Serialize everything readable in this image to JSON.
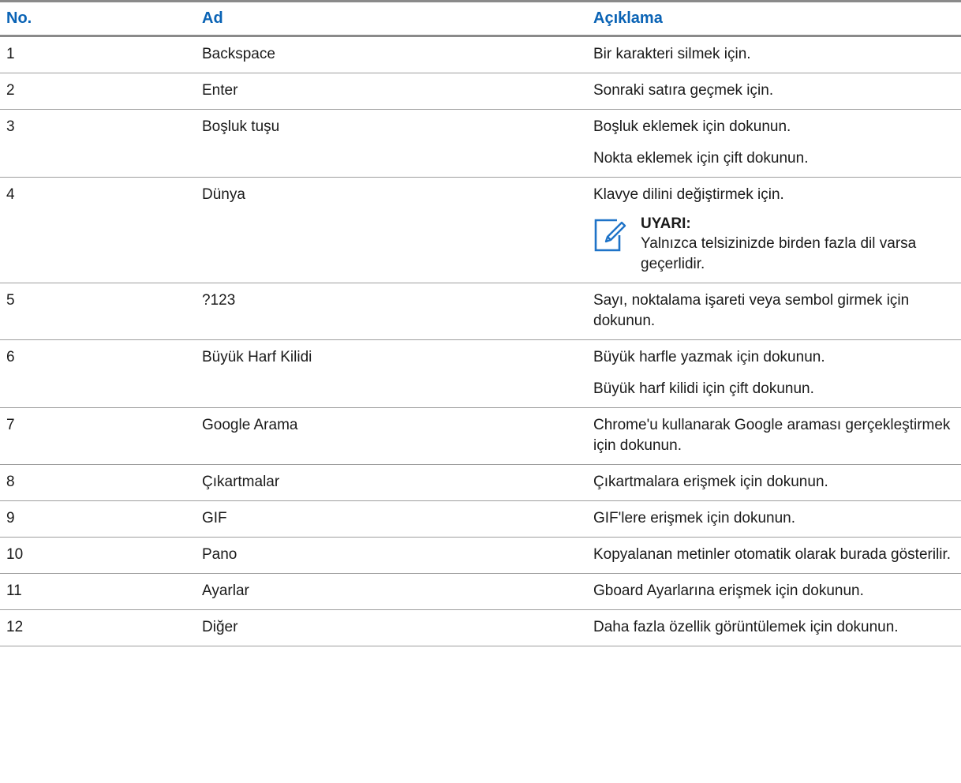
{
  "table": {
    "headers": [
      "No.",
      "Ad",
      "Açıklama"
    ],
    "rows": [
      {
        "no": "1",
        "name": "Backspace",
        "desc": [
          "Bir karakteri silmek için."
        ]
      },
      {
        "no": "2",
        "name": "Enter",
        "desc": [
          "Sonraki satıra geçmek için."
        ]
      },
      {
        "no": "3",
        "name": "Boşluk tuşu",
        "desc": [
          "Boşluk eklemek için dokunun.",
          "Nokta eklemek için çift dokunun."
        ]
      },
      {
        "no": "4",
        "name": "Dünya",
        "desc": [
          "Klavye dilini değiştirmek için."
        ],
        "note": {
          "icon": "note-pencil-icon",
          "title": "UYARI:",
          "text": "Yalnızca telsizinizde birden fazla dil varsa geçerlidir."
        }
      },
      {
        "no": "5",
        "name": "?123",
        "desc": [
          "Sayı, noktalama işareti veya sembol girmek için dokunun."
        ]
      },
      {
        "no": "6",
        "name": "Büyük Harf Kilidi",
        "desc": [
          "Büyük harfle yazmak için dokunun.",
          "Büyük harf kilidi için çift dokunun."
        ]
      },
      {
        "no": "7",
        "name": "Google Arama",
        "desc": [
          "Chrome'u kullanarak Google araması gerçekleştirmek için dokunun."
        ]
      },
      {
        "no": "8",
        "name": "Çıkartmalar",
        "desc": [
          "Çıkartmalara erişmek için dokunun."
        ]
      },
      {
        "no": "9",
        "name": "GIF",
        "desc": [
          "GIF'lere erişmek için dokunun."
        ]
      },
      {
        "no": "10",
        "name": "Pano",
        "desc": [
          "Kopyalanan metinler otomatik olarak burada gösterilir."
        ]
      },
      {
        "no": "11",
        "name": "Ayarlar",
        "desc": [
          "Gboard Ayarlarına erişmek için dokunun."
        ]
      },
      {
        "no": "12",
        "name": "Diğer",
        "desc": [
          "Daha fazla özellik görüntülemek için dokunun."
        ]
      }
    ]
  },
  "colors": {
    "header_text": "#0a63b5",
    "rule": "#8a8a8a",
    "icon": "#1e73c8"
  }
}
